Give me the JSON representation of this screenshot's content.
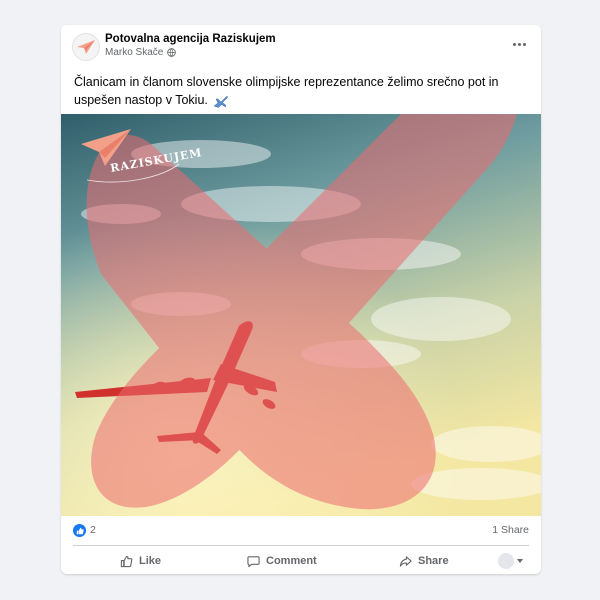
{
  "post": {
    "page_name": "Potovalna agencija Raziskujem",
    "author": "Marko Skače",
    "text": "Članicam in članom slovenske olimpijske reprezentance želimo srečno pot in uspešen nastop v Tokiu.",
    "emoji_icon": "airplane-icon"
  },
  "photo": {
    "logo_text": "RAZISKUJEM",
    "overlay": "red-x",
    "colors": {
      "sky_top": "#3f6f78",
      "sky_bottom": "#f1e6a6",
      "x_mark": "#e8676b",
      "plane": "#d0312d"
    }
  },
  "reactions": {
    "count": "2",
    "shares": "1 Share"
  },
  "actions": {
    "like": "Like",
    "comment": "Comment",
    "share": "Share"
  },
  "colors": {
    "accent": "#1877f2",
    "muted": "#65676b",
    "background": "#f0f2f5"
  }
}
